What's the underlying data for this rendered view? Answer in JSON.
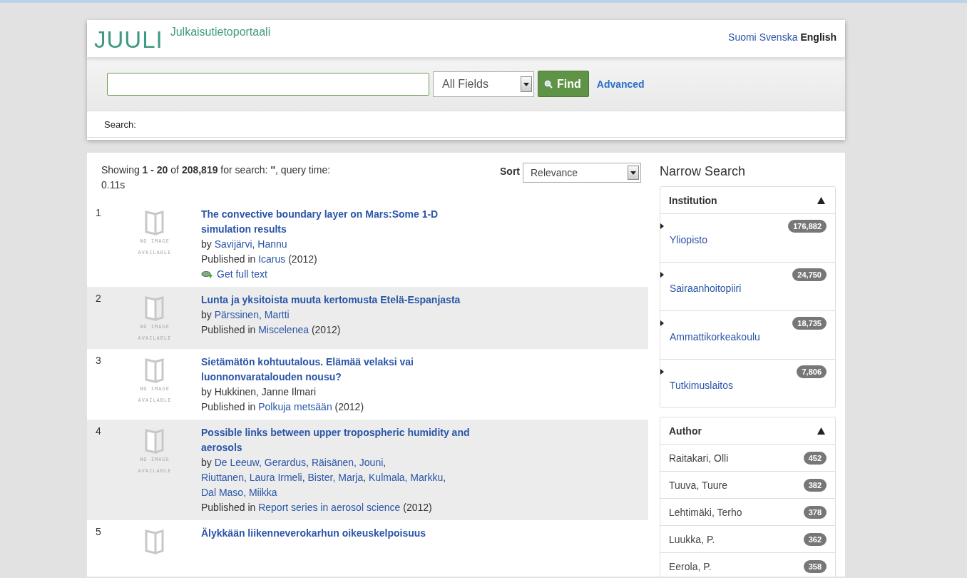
{
  "header": {
    "logo": "JUULI",
    "subtitle": "Julkaisutietoportaali",
    "languages": [
      {
        "label": "Suomi",
        "selected": false
      },
      {
        "label": "Svenska",
        "selected": false
      },
      {
        "label": "English",
        "selected": true
      }
    ]
  },
  "search": {
    "field": "All Fields",
    "find_button": "Find",
    "advanced_link": "Advanced",
    "breadcrumb": "Search:"
  },
  "results": {
    "summary": "Showing **1 - 20** of **208,819** for search: **''**, query time: 0.11s",
    "sort_label": "Sort",
    "sort_value": "Relevance",
    "items": [
      {
        "number": "1",
        "thumbnail_label": "NO IMAGE AVAILABLE",
        "title": "The convective boundary layer on Mars:Some 1-D simulation results",
        "by": "by",
        "authors": [
          {
            "name": "Savijärvi, Hannu",
            "linked": true
          }
        ],
        "published_in": "Published in",
        "journal": "Icarus",
        "year": "(2012)",
        "full_text": "Get full text"
      },
      {
        "number": "2",
        "thumbnail_label": "NO IMAGE AVAILABLE",
        "title": "Lunta ja yksitoista muuta kertomusta Etelä-Espanjasta",
        "by": "by",
        "authors": [
          {
            "name": "Pärssinen, Martti",
            "linked": true
          }
        ],
        "published_in": "Published in",
        "journal": "Miscelenea",
        "year": "(2012)"
      },
      {
        "number": "3",
        "thumbnail_label": "NO IMAGE AVAILABLE",
        "title": "Sietämätön kohtuutalous. Elämää velaksi vai luonnonvaratalouden nousu?",
        "by": "by",
        "authors": [
          {
            "name": "Hukkinen, Janne Ilmari",
            "linked": false
          }
        ],
        "published_in": "Published in",
        "journal": "Polkuja metsään",
        "year": "(2012)"
      },
      {
        "number": "4",
        "thumbnail_label": "NO IMAGE AVAILABLE",
        "title": "Possible links between upper tropospheric humidity and aerosols",
        "by": "by",
        "author_separator": ",",
        "authors": [
          {
            "name": "De Leeuw, Gerardus",
            "linked": true
          },
          {
            "name": "Räisänen, Jouni",
            "linked": true
          },
          {
            "name": "Riuttanen, Laura Irmeli",
            "linked": true
          },
          {
            "name": "Bister, Marja",
            "linked": true
          },
          {
            "name": "Kulmala, Markku",
            "linked": true
          },
          {
            "name": "Dal Maso, Miikka",
            "linked": true
          }
        ],
        "published_in": "Published in",
        "journal": "Report series in aerosol science",
        "year": "(2012)"
      },
      {
        "number": "5",
        "title": "Älykkään liikenneverokarhun oikeuskelpoisuus"
      }
    ]
  },
  "sidebar": {
    "title": "Narrow Search",
    "facets": [
      {
        "kind": "nested",
        "title": "Institution",
        "expanded": true,
        "items": [
          {
            "label": "Yliopisto",
            "count": "176,882"
          },
          {
            "label": "Sairaanhoitopiiri",
            "count": "24,750"
          },
          {
            "label": "Ammattikorkeakoulu",
            "count": "18,735"
          },
          {
            "label": "Tutkimuslaitos",
            "count": "7,806"
          }
        ]
      },
      {
        "kind": "flat",
        "title": "Author",
        "expanded": true,
        "items": [
          {
            "label": "Raitakari, Olli",
            "count": "452"
          },
          {
            "label": "Tuuva, Tuure",
            "count": "382"
          },
          {
            "label": "Lehtimäki, Terho",
            "count": "378"
          },
          {
            "label": "Luukka, P.",
            "count": "362"
          },
          {
            "label": "Eerola, P.",
            "count": "358"
          }
        ]
      }
    ]
  }
}
